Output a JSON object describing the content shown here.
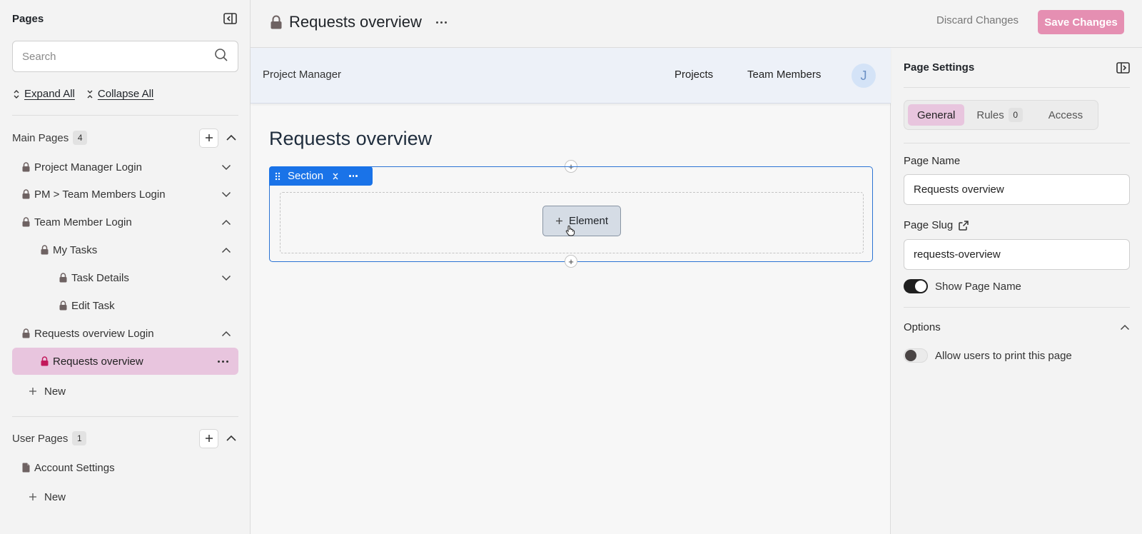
{
  "sidebar": {
    "title": "Pages",
    "search_placeholder": "Search",
    "expand_all": "Expand All",
    "collapse_all": "Collapse All",
    "main_group": {
      "label": "Main Pages",
      "count": "4",
      "items": [
        {
          "label": "Project Manager Login",
          "icon": "lock-icon",
          "expand": "chevron-down-icon"
        },
        {
          "label": "PM > Team Members Login",
          "icon": "lock-icon",
          "expand": "chevron-down-icon"
        },
        {
          "label": "Team Member Login",
          "icon": "lock-icon",
          "expand": "chevron-up-icon"
        },
        {
          "label": "My Tasks",
          "icon": "lock-icon",
          "expand": "chevron-up-icon"
        },
        {
          "label": "Task Details",
          "icon": "lock-icon",
          "expand": "chevron-down-icon"
        },
        {
          "label": "Edit Task",
          "icon": "lock-icon"
        },
        {
          "label": "Requests overview Login",
          "icon": "lock-icon",
          "expand": "chevron-up-icon"
        },
        {
          "label": "Requests overview",
          "icon": "lock-icon",
          "active": true
        }
      ],
      "new_label": "New"
    },
    "user_group": {
      "label": "User Pages",
      "count": "1",
      "items": [
        {
          "label": "Account Settings",
          "icon": "file-icon"
        }
      ],
      "new_label": "New"
    }
  },
  "topbar": {
    "title": "Requests overview",
    "discard_label": "Discard Changes",
    "save_label": "Save Changes"
  },
  "canvas": {
    "brand": "Project Manager",
    "nav_links": [
      "Projects",
      "Team Members"
    ],
    "avatar_initial": "J",
    "page_heading": "Requests overview",
    "section_label": "Section",
    "element_button": "Element"
  },
  "settings": {
    "title": "Page Settings",
    "tabs": [
      {
        "label": "General",
        "active": true
      },
      {
        "label": "Rules",
        "badge": "0"
      },
      {
        "label": "Access"
      }
    ],
    "page_name_label": "Page Name",
    "page_name_value": "Requests overview",
    "page_slug_label": "Page Slug",
    "page_slug_value": "requests-overview",
    "show_page_name_label": "Show Page Name",
    "show_page_name": true,
    "options_label": "Options",
    "print_label": "Allow users to print this page",
    "allow_print": false
  },
  "colors": {
    "accent_pink": "#e8c5de",
    "save_button": "#e58fb2",
    "section_blue": "#1a73e8",
    "active_lock": "#c2185b"
  }
}
